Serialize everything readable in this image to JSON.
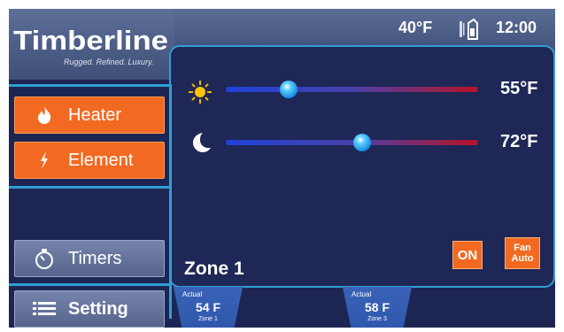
{
  "brand": {
    "name": "Timberline",
    "tagline": "Rugged. Refined. Luxury."
  },
  "status": {
    "outdoor_temp": "40°F",
    "time": "12:00",
    "thermometer_icon": "thermometer-icon"
  },
  "sidebar": {
    "heater": {
      "label": "Heater",
      "icon": "flame-icon"
    },
    "element": {
      "label": "Element",
      "icon": "lightning-bolt-icon"
    },
    "timers": {
      "label": "Timers",
      "icon": "stopwatch-icon"
    },
    "setting": {
      "label": "Setting",
      "icon": "list-icon"
    }
  },
  "setpoints": {
    "day": {
      "icon": "sun-icon",
      "value": "55°F",
      "fraction": 0.25
    },
    "night": {
      "icon": "moon-icon",
      "value": "72°F",
      "fraction": 0.54
    }
  },
  "zone": {
    "name": "Zone 1"
  },
  "controls": {
    "on_label": "ON",
    "fan_line1": "Fan",
    "fan_line2": "Auto"
  },
  "zone_tabs": [
    {
      "label": "Actual",
      "value": "54 F",
      "zone": "Zone 1"
    },
    {
      "label": "Actual",
      "value": "58 F",
      "zone": "Zone 3"
    }
  ],
  "colors": {
    "background": "#1d2653",
    "accent": "#2f9fd3",
    "orange": "#f26a21",
    "heat": "#b3142a",
    "cool": "#1e42d8"
  }
}
